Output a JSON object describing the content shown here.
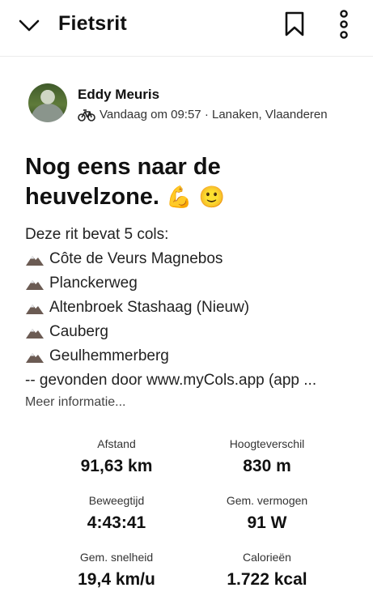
{
  "header": {
    "title": "Fietsrit"
  },
  "athlete": {
    "name": "Eddy Meuris",
    "activity_icon": "bike-icon",
    "meta": "Vandaag om 09:57 · Lanaken, Vlaanderen"
  },
  "activity": {
    "title": "Nog eens naar de heuvelzone.",
    "title_emojis": "💪 🙂",
    "description_lines": [
      "Deze rit bevat 5 cols:",
      "Côte de Veurs Magnebos",
      "Planckerweg",
      "Altenbroek Stashaag (Nieuw)",
      "Cauberg",
      "Geulhemmerberg",
      "-- gevonden door www.myCols.app (app ..."
    ],
    "more_info": "Meer informatie..."
  },
  "stats": [
    {
      "label": "Afstand",
      "value": "91,63 km"
    },
    {
      "label": "Hoogteverschil",
      "value": "830 m"
    },
    {
      "label": "Beweegtijd",
      "value": "4:43:41"
    },
    {
      "label": "Gem. vermogen",
      "value": "91 W"
    },
    {
      "label": "Gem. snelheid",
      "value": "19,4 km/u"
    },
    {
      "label": "Calorieën",
      "value": "1.722 kcal"
    }
  ]
}
